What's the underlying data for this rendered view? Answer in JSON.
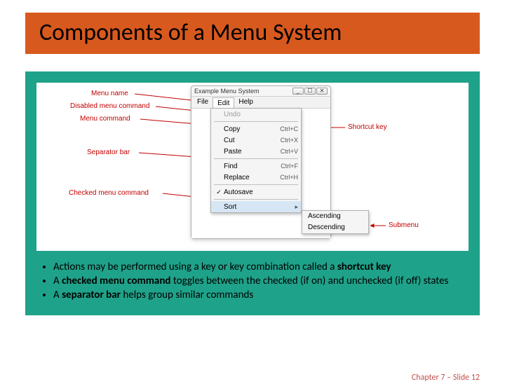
{
  "title": "Components of a Menu System",
  "labels": {
    "menu_name": "Menu name",
    "disabled_cmd": "Disabled menu command",
    "menu_cmd": "Menu command",
    "separator": "Separator bar",
    "checked_cmd": "Checked menu command",
    "shortcut_key": "Shortcut key",
    "submenu": "Submenu"
  },
  "window": {
    "title": "Example Menu System",
    "menubar": [
      "File",
      "Edit",
      "Help"
    ]
  },
  "dropdown": {
    "undo": "Undo",
    "copy": {
      "label": "Copy",
      "shortcut": "Ctrl+C"
    },
    "cut": {
      "label": "Cut",
      "shortcut": "Ctrl+X"
    },
    "paste": {
      "label": "Paste",
      "shortcut": "Ctrl+V"
    },
    "find": {
      "label": "Find",
      "shortcut": "Ctrl+F"
    },
    "replace": {
      "label": "Replace",
      "shortcut": "Ctrl+H"
    },
    "autosave": "Autosave",
    "sort": "Sort"
  },
  "submenu": {
    "asc": "Ascending",
    "desc": "Descending"
  },
  "bullets": {
    "b1a": "Actions may be performed using a key or key combination called a ",
    "b1b": "shortcut key",
    "b2a": "A ",
    "b2b": "checked menu command ",
    "b2c": "toggles between the  checked (if on) and unchecked (if off) states",
    "b3a": "A ",
    "b3b": "separator bar ",
    "b3c": "helps group similar commands"
  },
  "footer": "Chapter 7 – Slide 12"
}
